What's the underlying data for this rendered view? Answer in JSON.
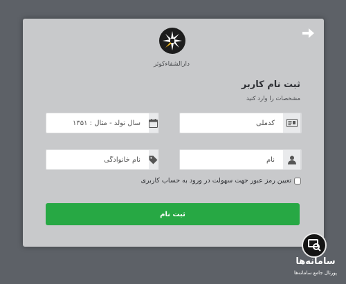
{
  "header": {
    "logo_caption": "دارالشفاءکوثر"
  },
  "form": {
    "title": "ثبت نام کاربر",
    "subtitle": "مشخصات را وارد کنید",
    "national_code_placeholder": "کدملی",
    "birth_year_placeholder": "سال تولد - مثال : ۱۳۵۱",
    "first_name_placeholder": "نام",
    "last_name_placeholder": "نام خانوادگی",
    "password_checkbox_label": "تعیین رمز عبور جهت سهولت در ورود به حساب کاربری",
    "submit_label": "ثبت نام"
  },
  "watermark": {
    "name": "سامانه‌ها",
    "tagline": "پورتال جامع سامانه‌ها"
  },
  "colors": {
    "background": "#5d6167",
    "card": "#c8c9cb",
    "submit": "#27a844"
  },
  "icons": {
    "back": "arrow-right-icon",
    "national_code": "id-card-icon",
    "birth_year": "calendar-icon",
    "first_name": "user-icon",
    "last_name": "tag-icon"
  }
}
